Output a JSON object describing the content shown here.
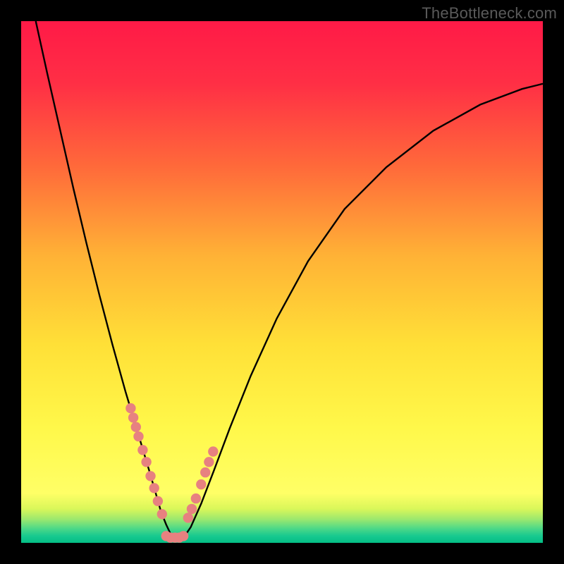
{
  "watermark": "TheBottleneck.com",
  "colors": {
    "frame": "#000000",
    "curve": "#000000",
    "dots": "#e78180",
    "gradient_stops": [
      {
        "offset": 0.0,
        "color": "#ff1a47"
      },
      {
        "offset": 0.12,
        "color": "#ff2f45"
      },
      {
        "offset": 0.28,
        "color": "#ff6a3a"
      },
      {
        "offset": 0.45,
        "color": "#ffb236"
      },
      {
        "offset": 0.62,
        "color": "#ffe037"
      },
      {
        "offset": 0.78,
        "color": "#fff84a"
      },
      {
        "offset": 0.905,
        "color": "#ffff66"
      },
      {
        "offset": 0.935,
        "color": "#d9f75a"
      },
      {
        "offset": 0.955,
        "color": "#9be86e"
      },
      {
        "offset": 0.972,
        "color": "#4fd987"
      },
      {
        "offset": 0.987,
        "color": "#17c98f"
      },
      {
        "offset": 1.0,
        "color": "#04be86"
      }
    ]
  },
  "chart_data": {
    "type": "line",
    "title": "",
    "xlabel": "",
    "ylabel": "",
    "xlim": [
      0,
      1
    ],
    "ylim": [
      0,
      1
    ],
    "series": [
      {
        "name": "bottleneck-curve",
        "x": [
          0.028,
          0.05,
          0.075,
          0.1,
          0.125,
          0.15,
          0.175,
          0.2,
          0.215,
          0.23,
          0.245,
          0.258,
          0.268,
          0.278,
          0.286,
          0.293,
          0.3,
          0.31,
          0.325,
          0.345,
          0.37,
          0.4,
          0.44,
          0.49,
          0.55,
          0.62,
          0.7,
          0.79,
          0.88,
          0.96,
          1.0
        ],
        "y": [
          1.0,
          0.9,
          0.79,
          0.68,
          0.575,
          0.475,
          0.38,
          0.29,
          0.24,
          0.19,
          0.14,
          0.095,
          0.06,
          0.035,
          0.018,
          0.008,
          0.003,
          0.008,
          0.03,
          0.075,
          0.14,
          0.22,
          0.32,
          0.43,
          0.54,
          0.64,
          0.72,
          0.79,
          0.84,
          0.87,
          0.88
        ]
      }
    ],
    "dots_left": {
      "name": "dot-cluster-left",
      "x": [
        0.21,
        0.215,
        0.22,
        0.225,
        0.233,
        0.24,
        0.248,
        0.255,
        0.262,
        0.27
      ],
      "y": [
        0.258,
        0.24,
        0.222,
        0.204,
        0.178,
        0.155,
        0.128,
        0.105,
        0.08,
        0.055
      ]
    },
    "dots_right": {
      "name": "dot-cluster-right",
      "x": [
        0.32,
        0.327,
        0.335,
        0.345,
        0.353,
        0.36,
        0.368
      ],
      "y": [
        0.048,
        0.065,
        0.085,
        0.112,
        0.135,
        0.155,
        0.175
      ]
    },
    "dots_bottom": {
      "name": "dot-cluster-bottom",
      "x": [
        0.278,
        0.286,
        0.295,
        0.303,
        0.311
      ],
      "y": [
        0.013,
        0.01,
        0.01,
        0.01,
        0.013
      ]
    }
  }
}
